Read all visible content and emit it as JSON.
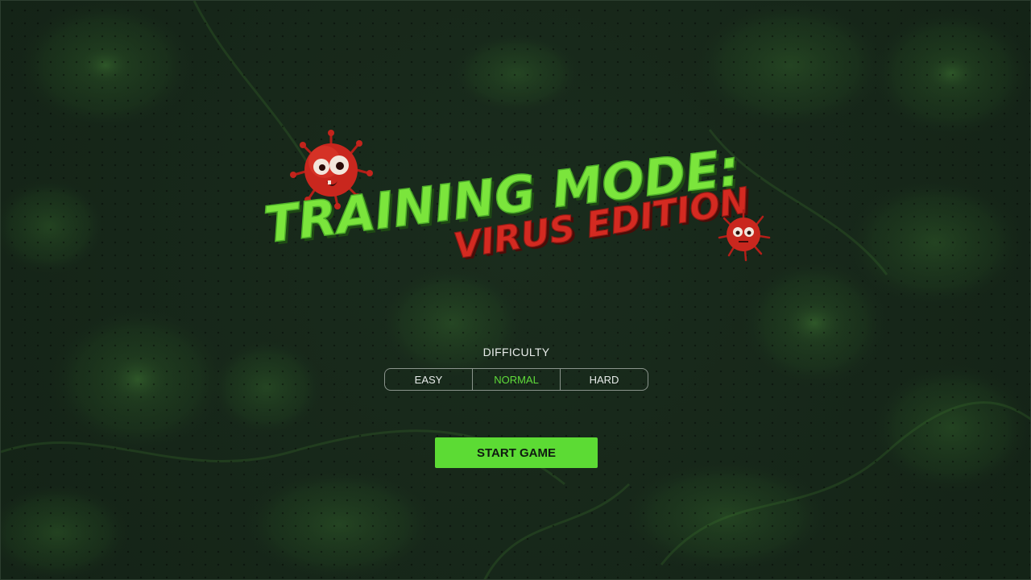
{
  "game": {
    "title_line1": "TRAINING MODE:",
    "title_line2": "VIRUS EDITION",
    "mascot_icon": "virus-mascot-icon"
  },
  "difficulty": {
    "label": "DIFFICULTY",
    "options": [
      "EASY",
      "NORMAL",
      "HARD"
    ],
    "selected": "NORMAL"
  },
  "start_button": {
    "label": "START GAME"
  },
  "colors": {
    "background": "#1a2c1d",
    "accent_green": "#5cdb34",
    "title_green": "#7be53c",
    "title_red": "#d42a21",
    "selected_text": "#5fdc3a",
    "text_light": "#e8ecea"
  }
}
